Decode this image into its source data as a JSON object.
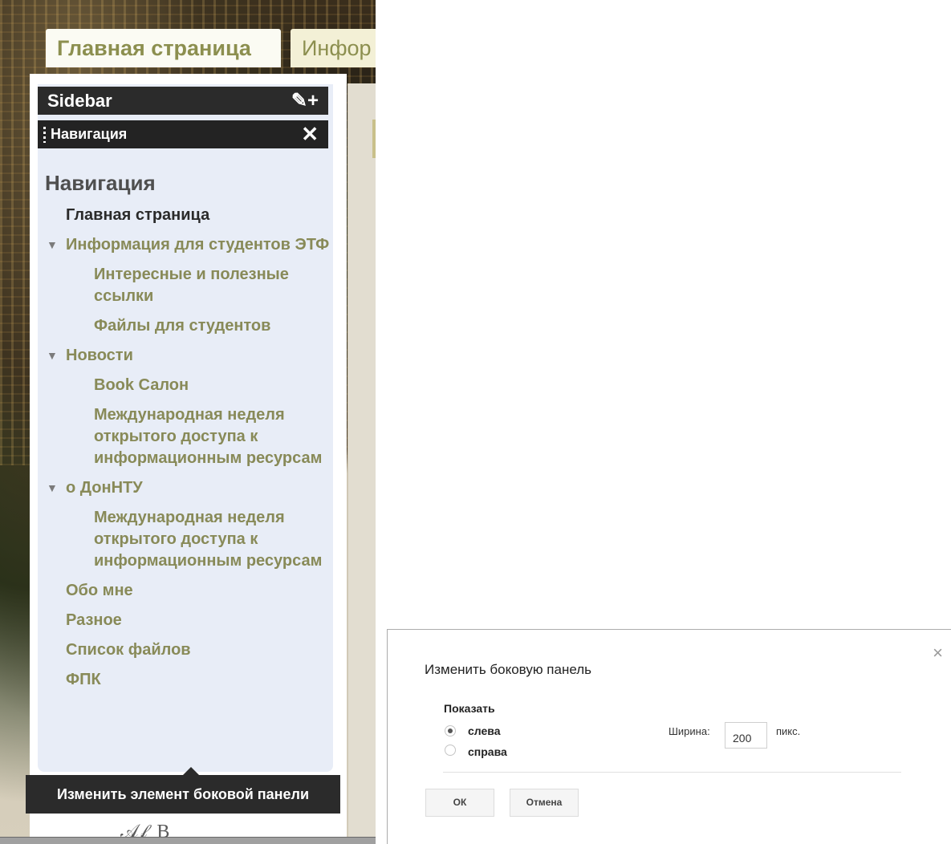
{
  "tabs": {
    "home": "Главная страница",
    "info_partial": "Инфор"
  },
  "sidebar": {
    "header_title": "Sidebar",
    "header_icons": "✎+",
    "widget_title": "Навигация",
    "nav_heading": "Навигация",
    "items": [
      {
        "label": "Главная страница",
        "level": "home"
      },
      {
        "label": "Информация для студентов ЭТФ",
        "level": "lvl1",
        "expanded": true
      },
      {
        "label": "Интересные и полезные ссылки",
        "level": "lvl2"
      },
      {
        "label": "Файлы для студентов",
        "level": "lvl2"
      },
      {
        "label": "Новости",
        "level": "lvl1",
        "expanded": true
      },
      {
        "label": "Book Салон",
        "level": "lvl2"
      },
      {
        "label": "Международная неделя открытого доступа к информационным ресурсам",
        "level": "lvl2"
      },
      {
        "label": "о ДонНТУ",
        "level": "lvl1",
        "expanded": true
      },
      {
        "label": "Международная неделя открытого доступа к информационным ресурсам",
        "level": "lvl2"
      },
      {
        "label": "Обо мне",
        "level": "lvl1"
      },
      {
        "label": "Разное",
        "level": "lvl1"
      },
      {
        "label": "Список файлов",
        "level": "lvl1"
      },
      {
        "label": "ФПК",
        "level": "lvl1"
      }
    ],
    "tooltip": "Изменить элемент боковой панели"
  },
  "dialog": {
    "title": "Изменить боковую панель",
    "show_label": "Показать",
    "option_left": "слева",
    "option_right": "справа",
    "selected": "слева",
    "width_label": "Ширина:",
    "width_value": "200",
    "width_unit": "пикс.",
    "ok_label": "ОК",
    "cancel_label": "Отмена"
  }
}
